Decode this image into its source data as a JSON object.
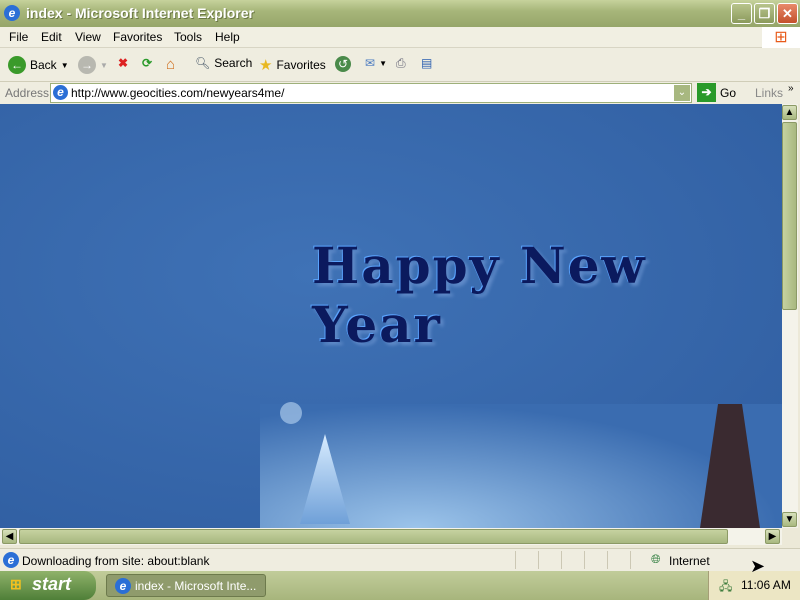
{
  "window": {
    "title": "index - Microsoft Internet Explorer"
  },
  "menu": [
    "File",
    "Edit",
    "View",
    "Favorites",
    "Tools",
    "Help"
  ],
  "toolbar": {
    "back": "Back",
    "search": "Search",
    "favorites": "Favorites"
  },
  "address": {
    "label": "Address",
    "url": "http://www.geocities.com/newyears4me/",
    "go": "Go",
    "links": "Links"
  },
  "page": {
    "heading": "Happy New Year"
  },
  "status": {
    "text": "Downloading from site: about:blank",
    "zone": "Internet"
  },
  "taskbar": {
    "start": "start",
    "task": "index - Microsoft Inte...",
    "clock": "11:06 AM"
  },
  "colors": {
    "page_background": "#3a6cb0",
    "titlebar": "#a7b67a"
  }
}
